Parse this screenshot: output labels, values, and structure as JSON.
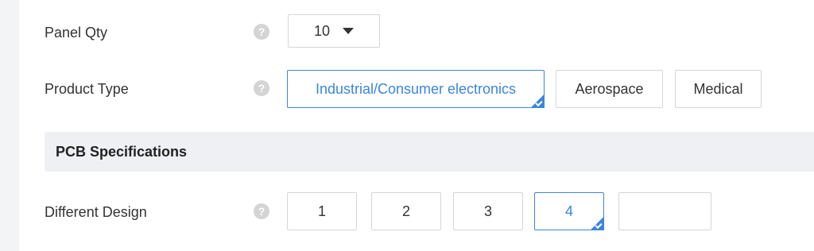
{
  "panel_qty": {
    "label": "Panel Qty",
    "help": "?",
    "selected_value": "10"
  },
  "product_type": {
    "label": "Product Type",
    "help": "?",
    "options": [
      {
        "label": "Industrial/Consumer electronics",
        "selected": true
      },
      {
        "label": "Aerospace",
        "selected": false
      },
      {
        "label": "Medical",
        "selected": false
      }
    ]
  },
  "section": {
    "title": "PCB Specifications"
  },
  "different_design": {
    "label": "Different Design",
    "help": "?",
    "options": [
      {
        "label": "1",
        "selected": false
      },
      {
        "label": "2",
        "selected": false
      },
      {
        "label": "3",
        "selected": false
      },
      {
        "label": "4",
        "selected": true
      },
      {
        "label": "",
        "selected": false
      }
    ]
  },
  "colors": {
    "accent": "#3b86e0",
    "border": "#d6d6d6",
    "section_bg": "#eef0f3",
    "help_icon_bg": "#d4d4d4"
  }
}
